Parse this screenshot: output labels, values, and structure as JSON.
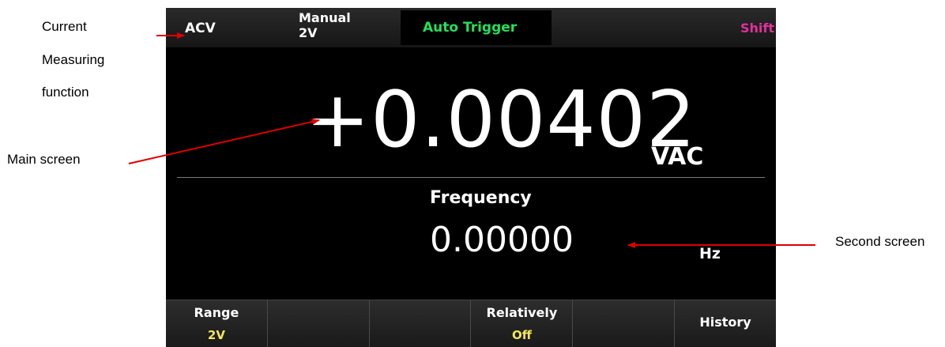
{
  "annotations": {
    "current_function": [
      "Current",
      "Measuring",
      "function"
    ],
    "main_screen": "Main screen",
    "second_screen": "Second screen",
    "arrow_color": "#e00000"
  },
  "topbar": {
    "function": "ACV",
    "range_mode": "Manual",
    "range_value": "2V",
    "trigger": "Auto Trigger",
    "shift": "Shift",
    "trigger_color": "#22e05a",
    "shift_color": "#e0309a"
  },
  "main": {
    "value": "+0.00402",
    "unit": "VAC"
  },
  "secondary": {
    "label": "Frequency",
    "value": "0.00000",
    "unit": "Hz"
  },
  "softkeys": [
    {
      "label": "Range",
      "value": "2V"
    },
    {
      "label": "",
      "value": ""
    },
    {
      "label": "",
      "value": ""
    },
    {
      "label": "Relatively",
      "value": "Off"
    },
    {
      "label": "",
      "value": ""
    },
    {
      "label": "History",
      "value": ""
    }
  ],
  "colors": {
    "screen_bg": "#000000",
    "softkey_value": "#f2e65a"
  }
}
